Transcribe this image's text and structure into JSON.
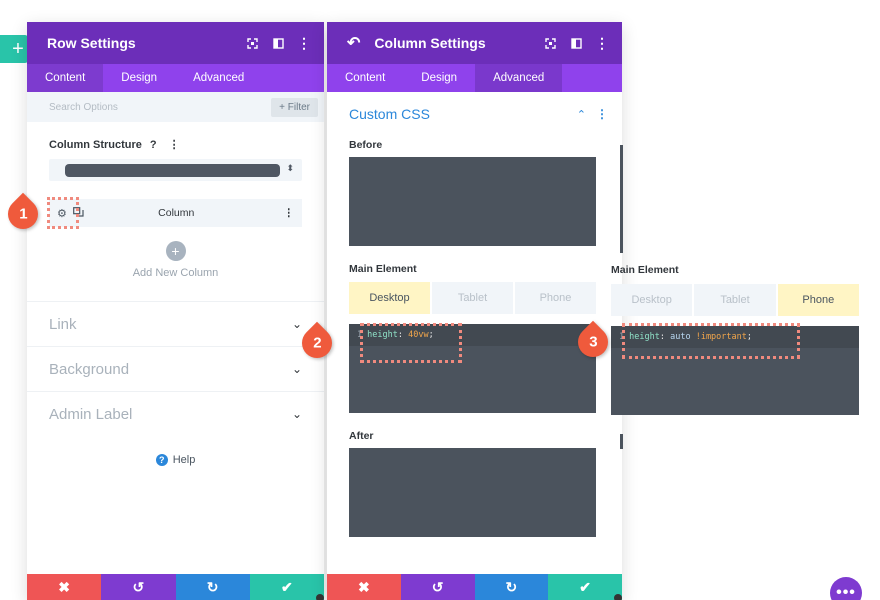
{
  "row_panel": {
    "title": "Row Settings",
    "tabs": [
      "Content",
      "Design",
      "Advanced"
    ],
    "active_tab": "Content",
    "search_placeholder": "Search Options",
    "filter_label": "+ Filter",
    "column_structure_label": "Column Structure",
    "column_item_label": "Column",
    "add_new_column_label": "Add New Column",
    "toggles": [
      "Link",
      "Background",
      "Admin Label"
    ],
    "help_label": "Help"
  },
  "col_panel": {
    "title": "Column Settings",
    "tabs": [
      "Content",
      "Design",
      "Advanced"
    ],
    "active_tab": "Advanced",
    "section_title": "Custom CSS",
    "before_label": "Before",
    "main_element_label": "Main Element",
    "after_label": "After",
    "device_tabs": [
      "Desktop",
      "Tablet",
      "Phone"
    ],
    "active_device": "Desktop",
    "code": {
      "line": "1",
      "prop": "height",
      "value": "40vw"
    }
  },
  "phone_view": {
    "main_element_label": "Main Element",
    "device_tabs": [
      "Desktop",
      "Tablet",
      "Phone"
    ],
    "active_device": "Phone",
    "code": {
      "line": "1",
      "prop": "height",
      "value": "auto",
      "important": "!important"
    }
  },
  "badges": [
    "1",
    "2",
    "3"
  ],
  "icons": {
    "add": "+",
    "back": "↶",
    "more": "⋮",
    "chevron_down": "⌄",
    "chevron_up": "⌃",
    "cancel": "✖",
    "undo": "↺",
    "redo": "↻",
    "save": "✔",
    "help": "?",
    "settings_gear": "⚙",
    "dots": "•••"
  },
  "colors": {
    "header_purple": "#6c2eb9",
    "tab_purple": "#8f42ec",
    "teal": "#29c4a9",
    "red": "#ef5555",
    "blue": "#2b87da",
    "code_bg": "#4b535d"
  }
}
